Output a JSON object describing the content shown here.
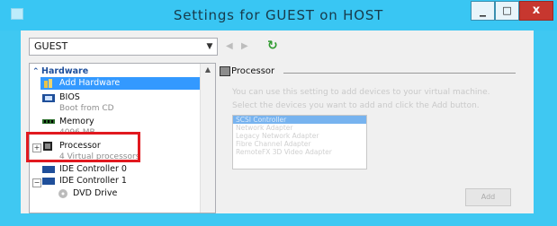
{
  "window": {
    "title": "Settings for GUEST on HOST",
    "controls": {
      "minimize": "_",
      "maximize": "□",
      "close": "x"
    }
  },
  "toolbar": {
    "vm_select": {
      "value": "GUEST"
    },
    "back_icon": "back-arrow-icon",
    "forward_icon": "forward-arrow-icon",
    "refresh_icon": "refresh-icon"
  },
  "tree": {
    "header": "Hardware",
    "items": [
      {
        "label": "Add Hardware",
        "icon": "add-hardware-icon",
        "selected": true
      },
      {
        "label": "BIOS",
        "sub": "Boot from CD",
        "icon": "bios-icon"
      },
      {
        "label": "Memory",
        "sub": "4096 MB",
        "icon": "memory-icon"
      },
      {
        "label": "Processor",
        "sub": "4 Virtual processors",
        "icon": "processor-icon"
      },
      {
        "label": "IDE Controller 0",
        "icon": "ide-controller-icon"
      },
      {
        "label": "IDE Controller 1",
        "icon": "ide-controller-icon"
      },
      {
        "label": "DVD Drive",
        "icon": "dvd-drive-icon"
      }
    ]
  },
  "panel": {
    "section_title": "Processor",
    "description_1": "You can use this setting to add devices to your virtual machine.",
    "description_2": "Select the devices you want to add and click the Add button.",
    "devices": [
      "SCSI Controller",
      "Network Adapter",
      "Legacy Network Adapter",
      "Fibre Channel Adapter",
      "RemoteFX 3D Video Adapter"
    ],
    "selected_device_index": 0,
    "add_button": "Add"
  },
  "colors": {
    "title_bar": "#39c6f3",
    "highlight_box": "#e1191f",
    "selection": "#3399ff"
  }
}
